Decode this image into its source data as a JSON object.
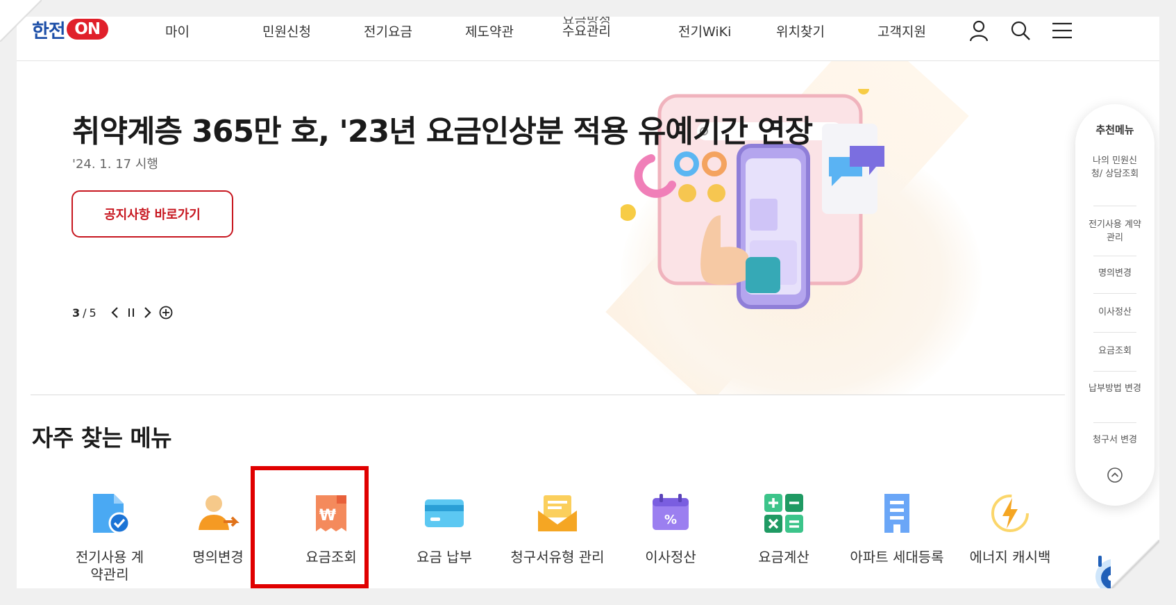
{
  "header": {
    "logo_text": "한전",
    "logo_on": "ON",
    "nav": [
      "마이",
      "민원신청",
      "전기요금",
      "제도약관"
    ],
    "nav_stack_top": "요금방정",
    "nav_stack_bottom": "수요관리",
    "nav_more": [
      "전기WiKi",
      "위치찾기",
      "고객지원"
    ],
    "icons": [
      "user-icon",
      "search-icon",
      "hamburger-menu-icon"
    ]
  },
  "hero": {
    "title": "취약계층 365만 호, '23년 요금인상분 적용 유예기간 연장",
    "date": "'24. 1. 17 시행",
    "button": "공지사항 바로가기",
    "pager_current": "3",
    "pager_sep": "/",
    "pager_total": "5"
  },
  "frequent_menu": {
    "title": "자주 찾는 메뉴",
    "items": [
      {
        "label": "전기사용 계약관리",
        "icon": "document-check-icon",
        "color": "#3aa0f0"
      },
      {
        "label": "명의변경",
        "icon": "person-transfer-icon",
        "color": "#f5a623"
      },
      {
        "label": "요금조회",
        "icon": "won-receipt-icon",
        "color": "#f27a4c"
      },
      {
        "label": "요금 납부",
        "icon": "credit-card-icon",
        "color": "#4cc1ee"
      },
      {
        "label": "청구서유형 관리",
        "icon": "envelope-icon",
        "color": "#f5a623"
      },
      {
        "label": "이사정산",
        "icon": "calendar-percent-icon",
        "color": "#8b6be0"
      },
      {
        "label": "요금계산",
        "icon": "calculator-icon",
        "color": "#2fb87a"
      },
      {
        "label": "아파트 세대등록",
        "icon": "building-icon",
        "color": "#5a9cf5"
      },
      {
        "label": "에너지 캐시백",
        "icon": "energy-bolt-icon",
        "color": "#f5b823"
      }
    ]
  },
  "rail": {
    "title": "추천메뉴",
    "items": [
      "나의 민원신청/ 상담조회",
      "전기사용 계약관리",
      "명의변경",
      "이사정산",
      "요금조회",
      "납부방법 변경",
      "청구서 변경"
    ]
  },
  "colors": {
    "brand_red": "#c7161f",
    "brand_blue": "#1d4fa8",
    "highlight_red": "#e00000"
  }
}
